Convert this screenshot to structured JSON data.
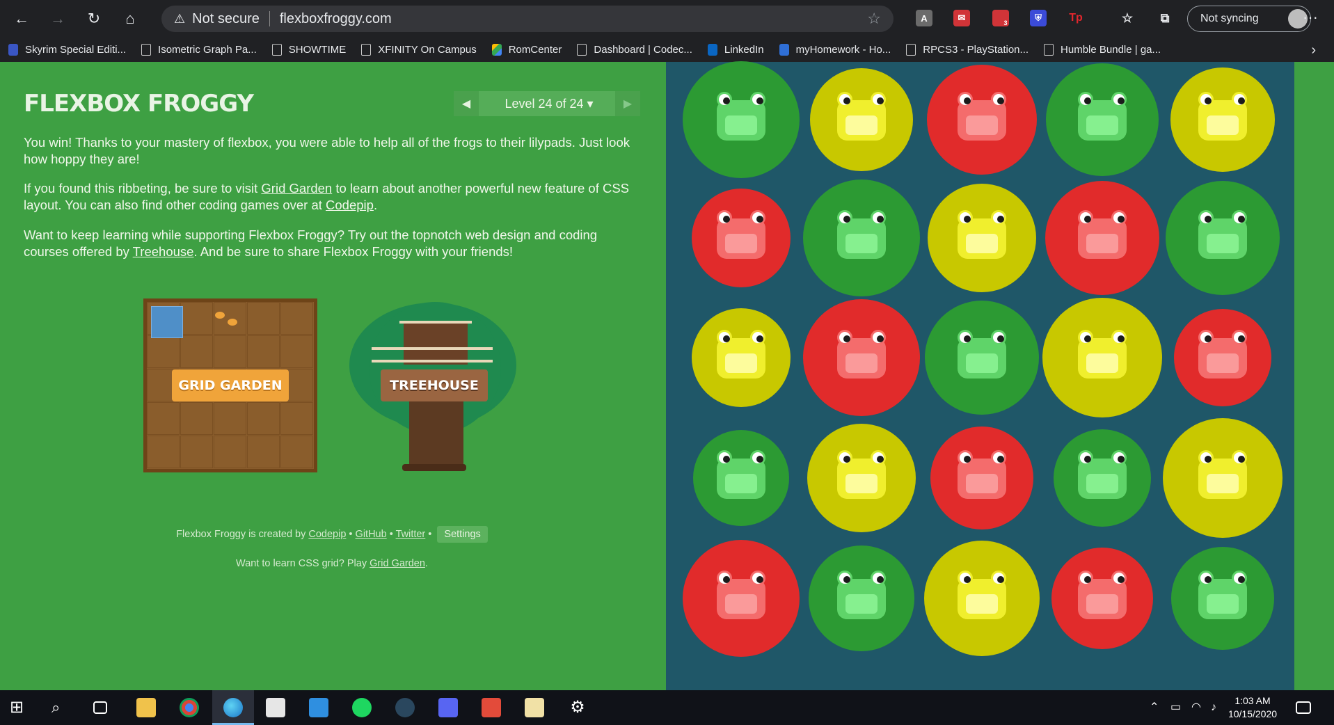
{
  "browser": {
    "security_label": "Not secure",
    "url": "flexboxfroggy.com",
    "sync_label": "Not syncing",
    "ext_badge": "3"
  },
  "bookmarks": [
    "Skyrim Special Editi...",
    "Isometric Graph Pa...",
    "SHOWTIME",
    "XFINITY On Campus",
    "RomCenter",
    "Dashboard | Codec...",
    "LinkedIn",
    "myHomework - Ho...",
    "RPCS3 - PlayStation...",
    "Humble Bundle | ga..."
  ],
  "game": {
    "title": "FLEXBOX FROGGY",
    "level_label": "Level 24 of 24 ▾",
    "win_text": "You win! Thanks to your mastery of flexbox, you were able to help all of the frogs to their lilypads. Just look how hoppy they are!",
    "grid_text_before": "If you found this ribbeting, be sure to visit ",
    "grid_link": "Grid Garden",
    "grid_text_after": " to learn about another powerful new feature of CSS layout. You can also find other coding games over at ",
    "codepip_link": "Codepip",
    "period": ".",
    "treehouse_text_before": "Want to keep learning while supporting Flexbox Froggy? Try out the topnotch web design and coding courses offered by ",
    "treehouse_link": "Treehouse",
    "treehouse_text_after": ". And be sure to share Flexbox Froggy with your friends!",
    "grid_garden_button": "GRID GARDEN",
    "treehouse_button": "TREEHOUSE",
    "footer_created": "Flexbox Froggy is created by ",
    "footer_codepip": "Codepip",
    "footer_github": "GitHub",
    "footer_twitter": "Twitter",
    "footer_sep": " • ",
    "settings_label": "Settings",
    "footer2_text": "Want to learn CSS grid? Play ",
    "footer2_link": "Grid Garden",
    "footer2_end": "."
  },
  "frogs": [
    [
      "green",
      "yellow",
      "red",
      "green",
      "yellow"
    ],
    [
      "red",
      "green",
      "yellow",
      "red",
      "green"
    ],
    [
      "yellow",
      "red",
      "green",
      "yellow",
      "red"
    ],
    [
      "green",
      "yellow",
      "red",
      "green",
      "yellow"
    ],
    [
      "red",
      "green",
      "yellow",
      "red",
      "green"
    ]
  ],
  "colors": {
    "green": {
      "pad": "#2c9a33",
      "body": "#5fd469",
      "belly": "#86f08f"
    },
    "yellow": {
      "pad": "#c8c800",
      "body": "#f0ef2d",
      "belly": "#fdfc9c"
    },
    "red": {
      "pad": "#e12b2b",
      "body": "#f46c6c",
      "belly": "#fa9a9a"
    }
  },
  "taskbar": {
    "time": "1:03 AM",
    "date": "10/15/2020"
  }
}
